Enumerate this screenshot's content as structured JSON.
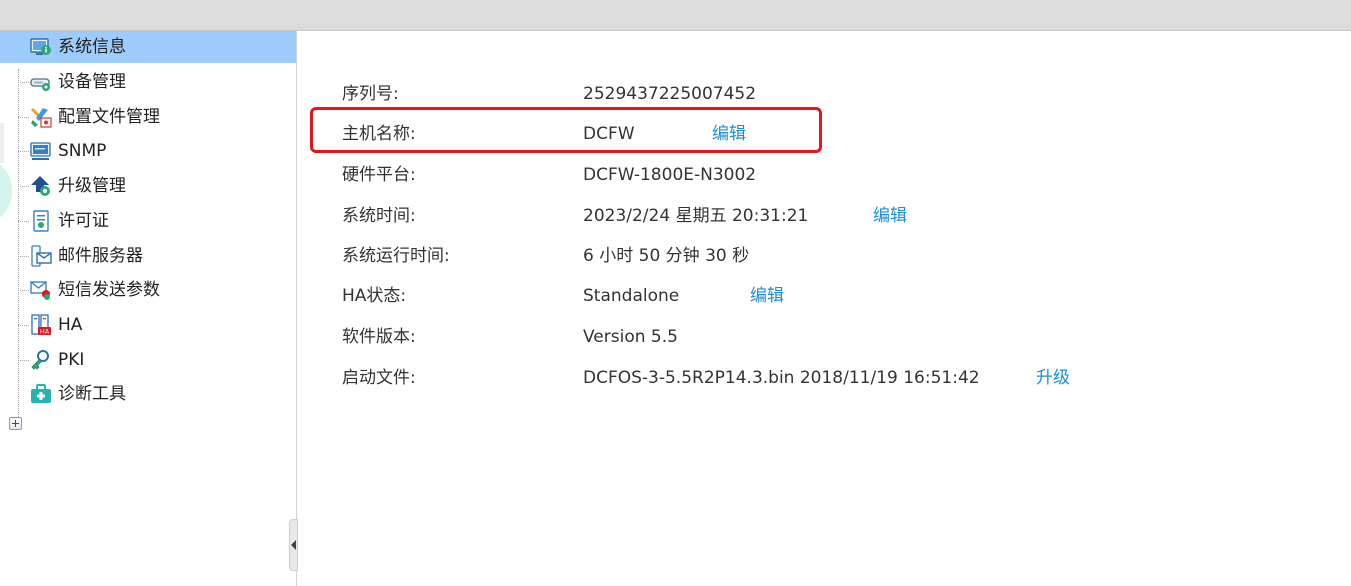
{
  "sidebar": {
    "items": [
      {
        "label": "系统信息",
        "icon": "system-info-icon",
        "selected": true
      },
      {
        "label": "设备管理",
        "icon": "device-manage-icon"
      },
      {
        "label": "配置文件管理",
        "icon": "config-file-icon"
      },
      {
        "label": "SNMP",
        "icon": "snmp-icon"
      },
      {
        "label": "升级管理",
        "icon": "upgrade-icon"
      },
      {
        "label": "许可证",
        "icon": "license-icon"
      },
      {
        "label": "邮件服务器",
        "icon": "mail-server-icon"
      },
      {
        "label": "短信发送参数",
        "icon": "sms-icon"
      },
      {
        "label": "HA",
        "icon": "ha-icon",
        "badge": "HA"
      },
      {
        "label": "PKI",
        "icon": "pki-key-icon"
      },
      {
        "label": "诊断工具",
        "icon": "diagnostic-toolbox-icon",
        "expandable": true
      }
    ]
  },
  "info": {
    "serial_label": "序列号:",
    "serial_value": "2529437225007452",
    "hostname_label": "主机名称:",
    "hostname_value": "DCFW",
    "hostname_edit": "编辑",
    "hardware_label": "硬件平台:",
    "hardware_value": "DCFW-1800E-N3002",
    "systime_label": "系统时间:",
    "systime_value": "2023/2/24 星期五 20:31:21",
    "systime_edit": "编辑",
    "uptime_label": "系统运行时间:",
    "uptime_value": "6 小时 50 分钟 30 秒",
    "ha_label": "HA状态:",
    "ha_value": "Standalone",
    "ha_edit": "编辑",
    "version_label": "软件版本:",
    "version_value": "Version 5.5",
    "boot_label": "启动文件:",
    "boot_value": "DCFOS-3-5.5R2P14.3.bin 2018/11/19 16:51:42",
    "boot_upgrade": "升级"
  },
  "colors": {
    "selected_bg": "#9dcbfc",
    "link": "#1a8fd8",
    "highlight_border": "#e8141c"
  }
}
